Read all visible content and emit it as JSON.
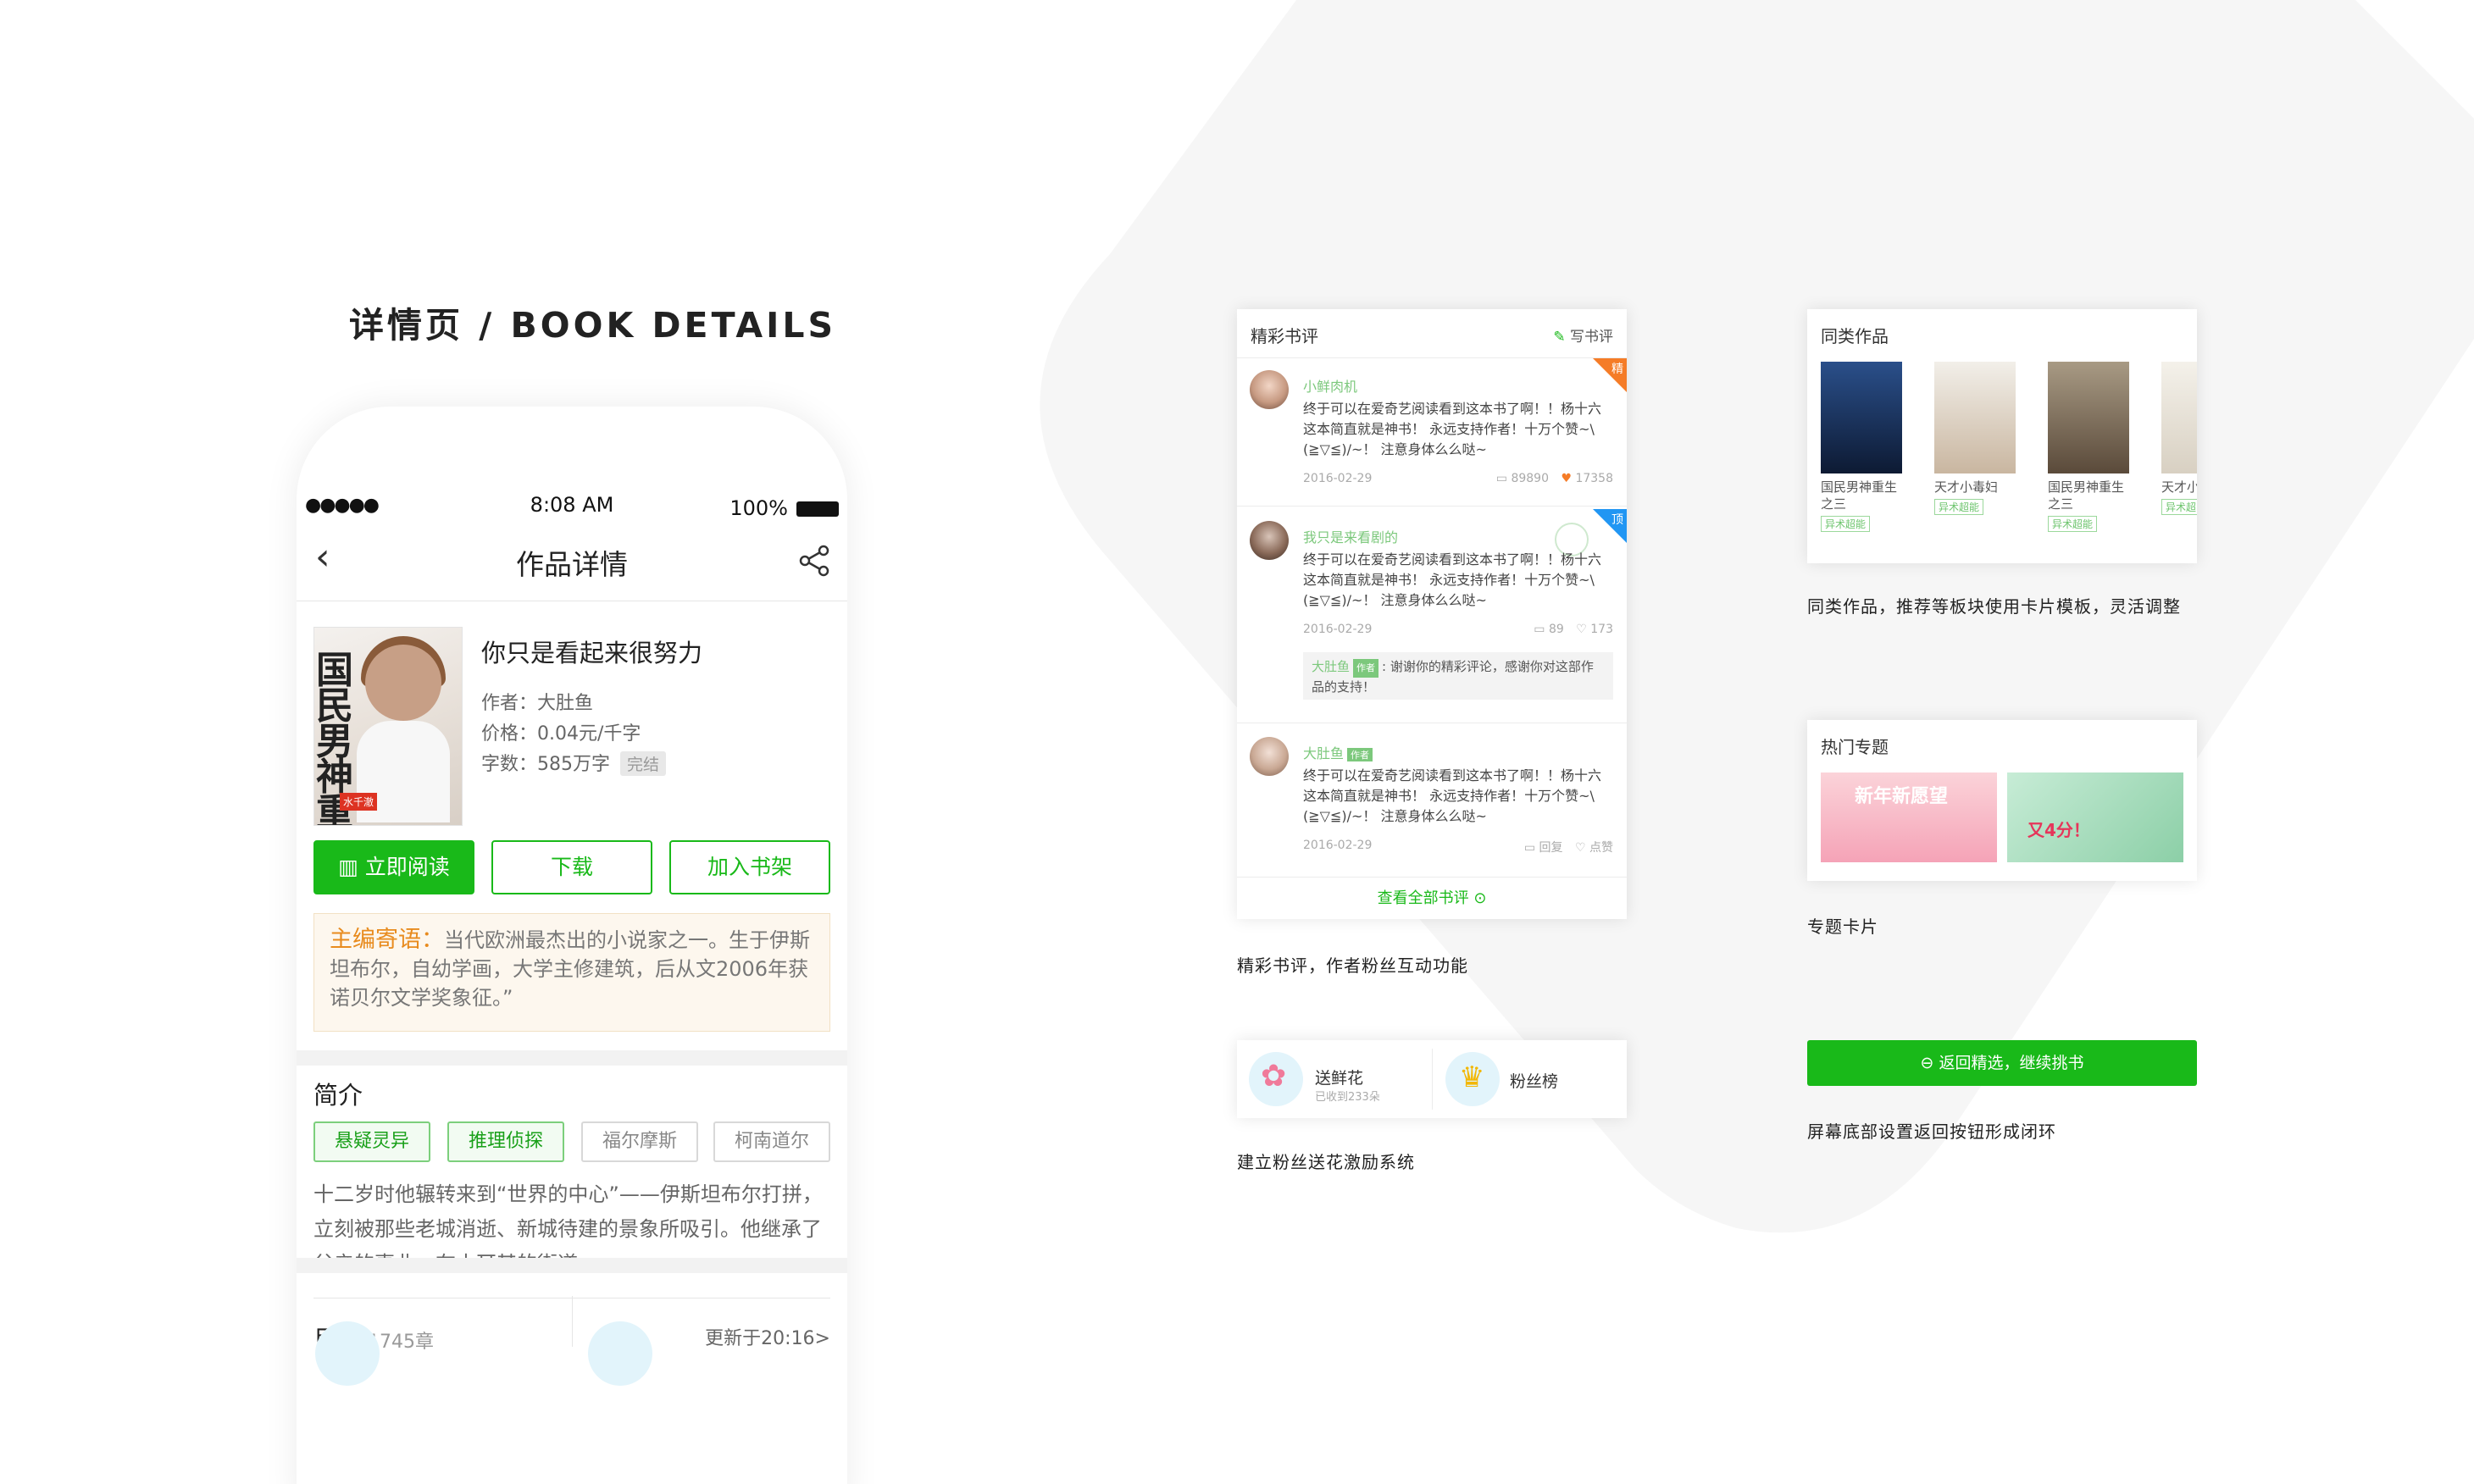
{
  "section_title": "详情页 / BOOK DETAILS",
  "phone": {
    "status": {
      "dots": "●●●●●",
      "time": "8:08 AM",
      "battery": "100%"
    },
    "nav_title": "作品详情",
    "book": {
      "title": "你只是看起来很努力",
      "author": "作者：大肚鱼",
      "price": "价格：0.04元/千字",
      "words": "字数：585万字",
      "status_badge": "完结",
      "cover_title": "国民男神重生之",
      "cover_tag": "水千澈"
    },
    "buttons": {
      "read": "立即阅读",
      "download": "下载",
      "shelf": "加入书架"
    },
    "editor": {
      "label": "主编寄语：",
      "text": "当代欧洲最杰出的小说家之一。生于伊斯坦布尔，自幼学画，大学主修建筑，后从文2006年获诺贝尔文学奖象征。”"
    },
    "intro": {
      "heading": "简介",
      "tags": [
        "悬疑灵异",
        "推理侦探",
        "福尔摩斯",
        "柯南道尔"
      ],
      "text": "十二岁时他辗转来到“世界的中心”——伊斯坦布尔打拼，立刻被那些老城消逝、新城待建的景象所吸引。他继承了父亲的事业，在土耳其的街道..."
    },
    "catalog": {
      "label": "目录",
      "count": "1745章",
      "updated": "更新于20:16>"
    }
  },
  "reviews_card": {
    "title": "精彩书评",
    "write": "写书评",
    "items": [
      {
        "name": "小鲜肉机",
        "text": "终于可以在爱奇艺阅读看到这本书了啊！！杨十六这本简直就是神书！ 永远支持作者！十万个赞~\\(≧▽≦)/~！ 注意身体么么哒~",
        "date": "2016-02-29",
        "comments": "89890",
        "likes": "17358",
        "badge": "精"
      },
      {
        "name": "我只是来看剧的",
        "text": "终于可以在爱奇艺阅读看到这本书了啊！！杨十六这本简直就是神书！ 永远支持作者！十万个赞~\\(≧▽≦)/~！ 注意身体么么哒~",
        "date": "2016-02-29",
        "comments": "89",
        "likes": "173",
        "badge": "顶",
        "reply_name": "大肚鱼",
        "reply_tag": "作者",
        "reply_text": "谢谢你的精彩评论，感谢你对这部作品的支持！"
      },
      {
        "name": "大肚鱼",
        "name_tag": "作者",
        "text": "终于可以在爱奇艺阅读看到这本书了啊！！杨十六这本简直就是神书！ 永远支持作者！十万个赞~\\(≧▽≦)/~！ 注意身体么么哒~",
        "date": "2016-02-29",
        "comments": "回复",
        "likes": "点赞"
      }
    ],
    "see_all": "查看全部书评 ⊙",
    "caption": "精彩书评，作者粉丝互动功能"
  },
  "similar_card": {
    "title": "同类作品",
    "books": [
      {
        "title": "国民男神重生之三",
        "tag": "异术超能"
      },
      {
        "title": "天才小毒妇",
        "tag": "异术超能"
      },
      {
        "title": "国民男神重生之三",
        "tag": "异术超能"
      },
      {
        "title": "天才小",
        "tag": "异术超"
      }
    ],
    "caption": "同类作品，推荐等板块使用卡片模板，灵活调整"
  },
  "topic_card": {
    "title": "热门专题",
    "banner1": "新年新愿望",
    "banner2": "又4分！",
    "caption": "专题卡片"
  },
  "flower_card": {
    "send": "送鲜花",
    "received": "已收到233朵",
    "fans": "粉丝榜",
    "caption": "建立粉丝送花激励系统"
  },
  "back_button": {
    "label": "返回精选，继续挑书",
    "caption": "屏幕底部设置返回按钮形成闭环"
  },
  "colors": {
    "accent": "#19b919",
    "orange": "#e88b1e",
    "blue_badge": "#2196f3",
    "orange_badge": "#f57c27"
  }
}
